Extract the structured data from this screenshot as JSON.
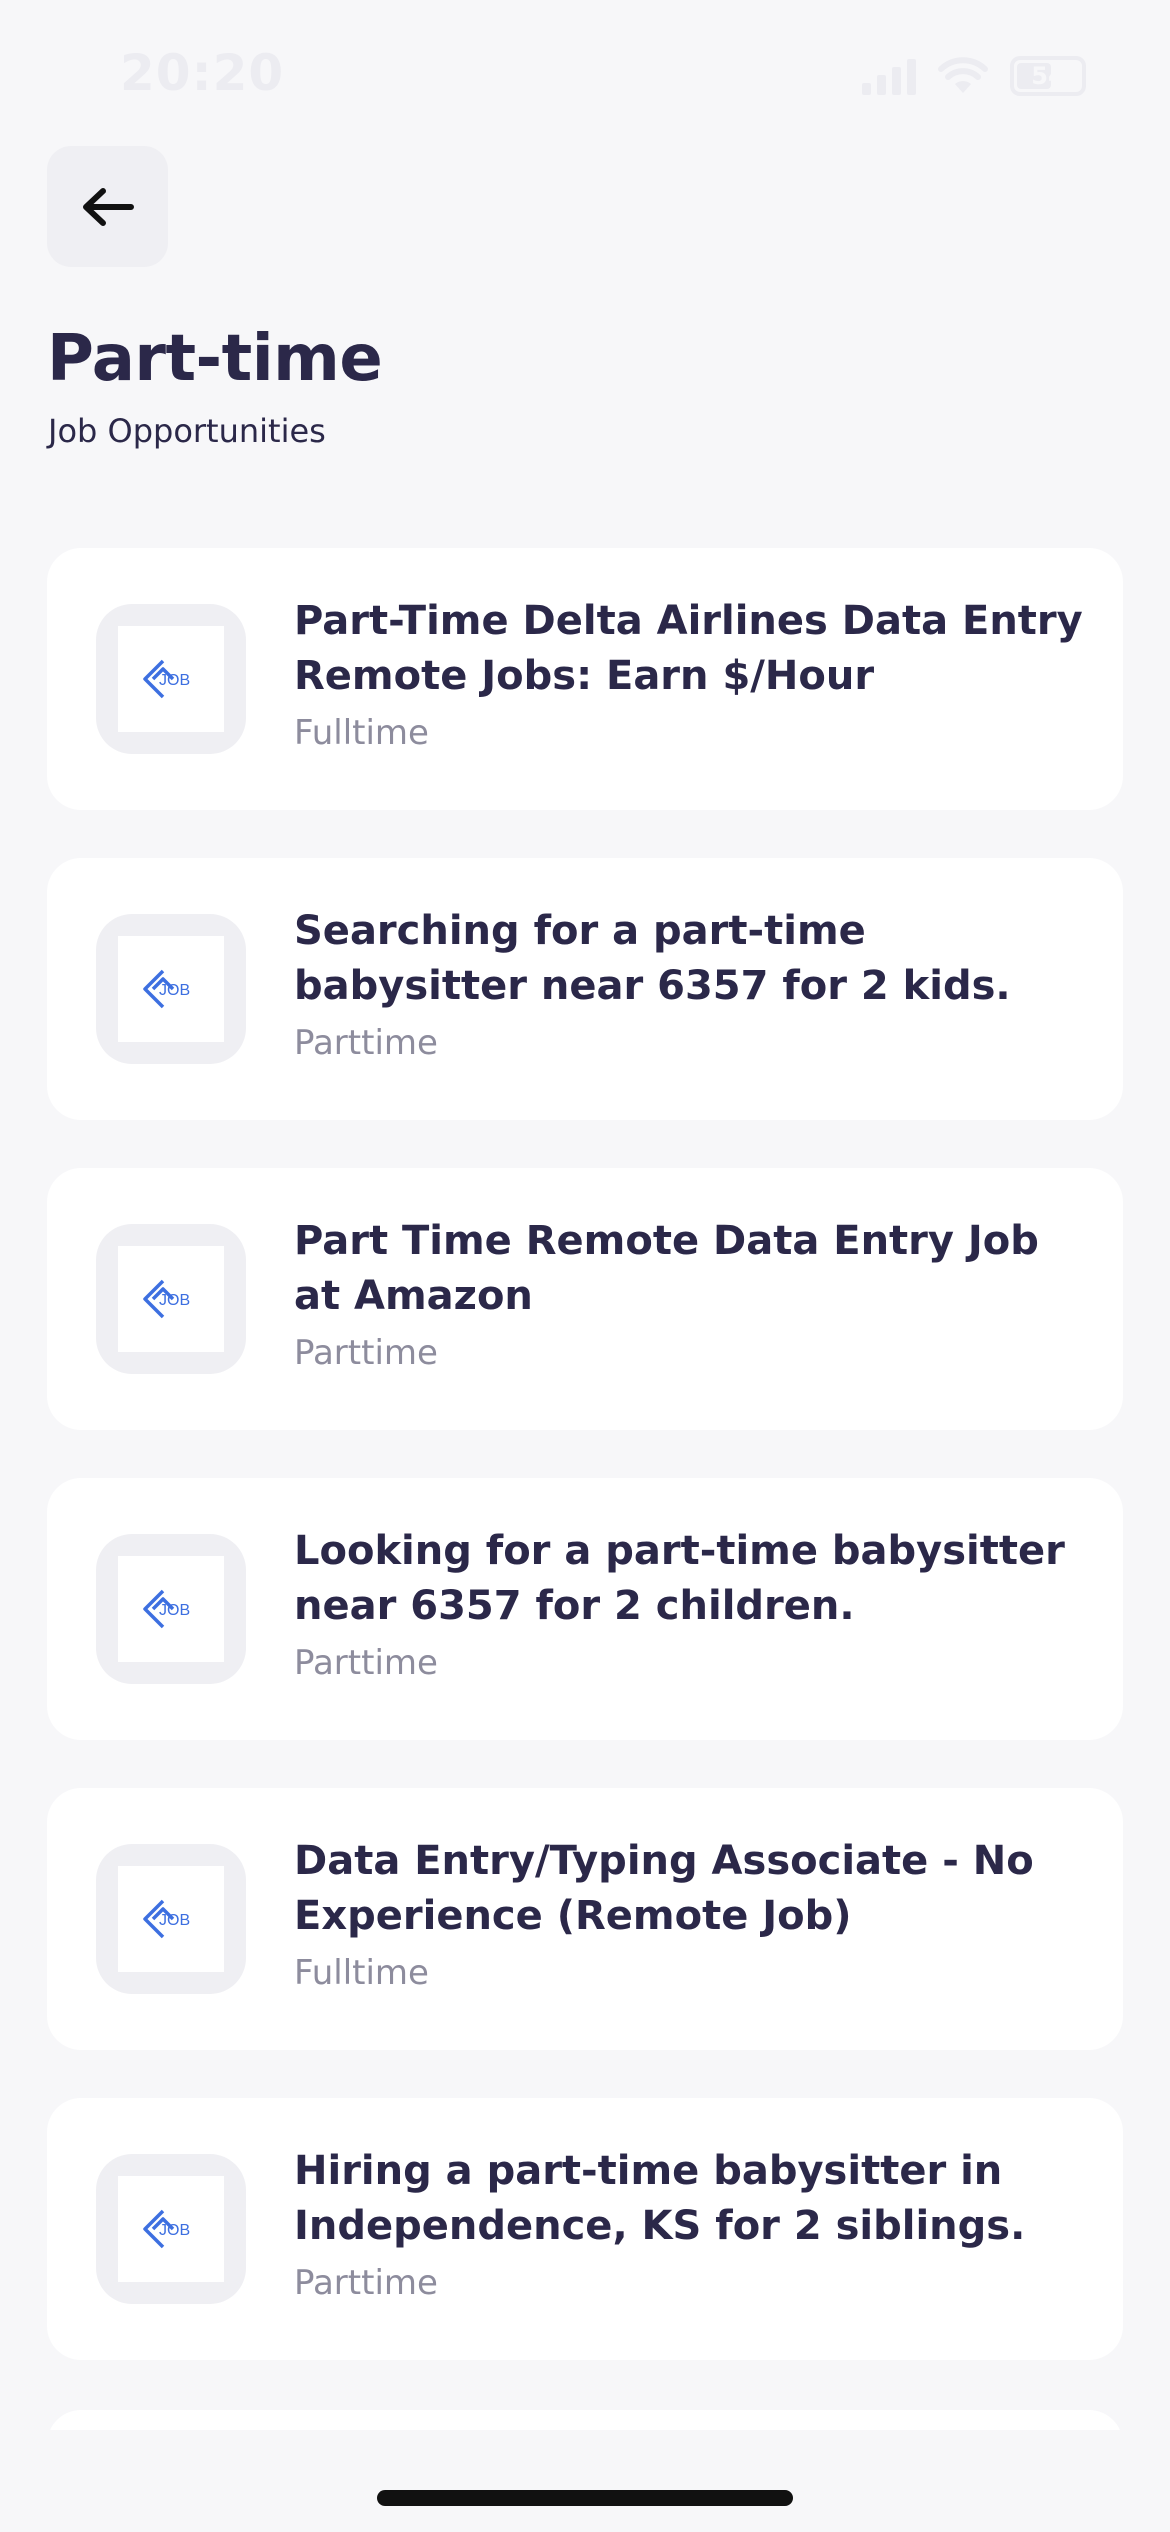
{
  "status_bar": {
    "time": "20:20",
    "battery_level": "54"
  },
  "header": {
    "back_icon": "arrow-left-icon",
    "title": "Part-time",
    "subtitle": "Job Opportunities"
  },
  "jobs": [
    {
      "title": "Part-Time Delta Airlines Data Entry Remote Jobs: Earn $/Hour",
      "type": "Fulltime",
      "logo_text": "JOB"
    },
    {
      "title": "Searching for a part-time babysitter near 6357 for 2 kids.",
      "type": "Parttime",
      "logo_text": "JOB"
    },
    {
      "title": "Part Time Remote Data Entry Job at Amazon",
      "type": "Parttime",
      "logo_text": "JOB"
    },
    {
      "title": "Looking for a part-time babysitter near 6357 for 2 children.",
      "type": "Parttime",
      "logo_text": "JOB"
    },
    {
      "title": "Data Entry/Typing Associate - No Experience (Remote Job)",
      "type": "Fulltime",
      "logo_text": "JOB"
    },
    {
      "title": "Hiring a part-time babysitter in Independence, KS for 2 siblings.",
      "type": "Parttime",
      "logo_text": "JOB"
    }
  ],
  "colors": {
    "background": "#f7f7f9",
    "text_primary": "#2b2849",
    "text_secondary": "#8d8c9d",
    "logo_blue": "#3d6fe0"
  }
}
